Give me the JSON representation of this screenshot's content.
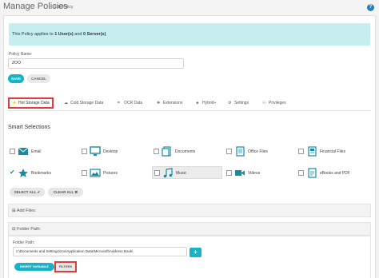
{
  "header": {
    "title": "Manage Policies",
    "subtitle": "Edit Policy",
    "help": "?"
  },
  "info": {
    "prefix": "This Policy applies to ",
    "users": "1 User(s)",
    "mid": " and ",
    "servers": "0 Server(s)"
  },
  "form": {
    "policy_name_label": "Policy Name:",
    "policy_name_value": "ZOO",
    "save": "SAVE",
    "cancel": "CANCEL"
  },
  "tabs": [
    {
      "label": "Hot Storage Data",
      "icon": "lightning-icon"
    },
    {
      "label": "Cold Storage Data",
      "icon": "cloud-icon"
    },
    {
      "label": "OCR Data",
      "icon": "ocr-icon"
    },
    {
      "label": "Extensions",
      "icon": "puzzle-icon"
    },
    {
      "label": "Hybrid+",
      "icon": "shield-icon"
    },
    {
      "label": "Settings",
      "icon": "gears-icon"
    },
    {
      "label": "Privileges",
      "icon": "users-icon"
    }
  ],
  "smart": {
    "title": "Smart Selections",
    "items": [
      {
        "label": "Email",
        "icon": "email-icon"
      },
      {
        "label": "Desktop",
        "icon": "desktop-icon"
      },
      {
        "label": "Documents",
        "icon": "documents-icon"
      },
      {
        "label": "Office Files",
        "icon": "office-files-icon"
      },
      {
        "label": "Financial Files",
        "icon": "financial-files-icon"
      },
      {
        "label": "Bookmarks",
        "icon": "bookmark-star-icon"
      },
      {
        "label": "Pictures",
        "icon": "pictures-icon"
      },
      {
        "label": "Music",
        "icon": "music-icon"
      },
      {
        "label": "Videos",
        "icon": "video-camera-icon"
      },
      {
        "label": "eBooks and PDF",
        "icon": "ebook-pdf-icon"
      }
    ],
    "select_all": "SELECT ALL ✔",
    "clear_all": "CLEAR ALL ✖"
  },
  "panels": {
    "add_files": "⊞ Add Files:",
    "folder_path": "⊟ Folder Path:"
  },
  "folder": {
    "label": "Folder Path:",
    "value": "c:\\Documents and Settings\\zoo\\Application Data\\Microsoft\\Address Book\\",
    "plus": "+",
    "insert_variable": "INSERT VARIABLE",
    "filters": "FILTERS"
  },
  "colors": {
    "accent": "#17b3c6",
    "highlight_border": "#e23b3b",
    "info_bg": "#c6eef0"
  }
}
